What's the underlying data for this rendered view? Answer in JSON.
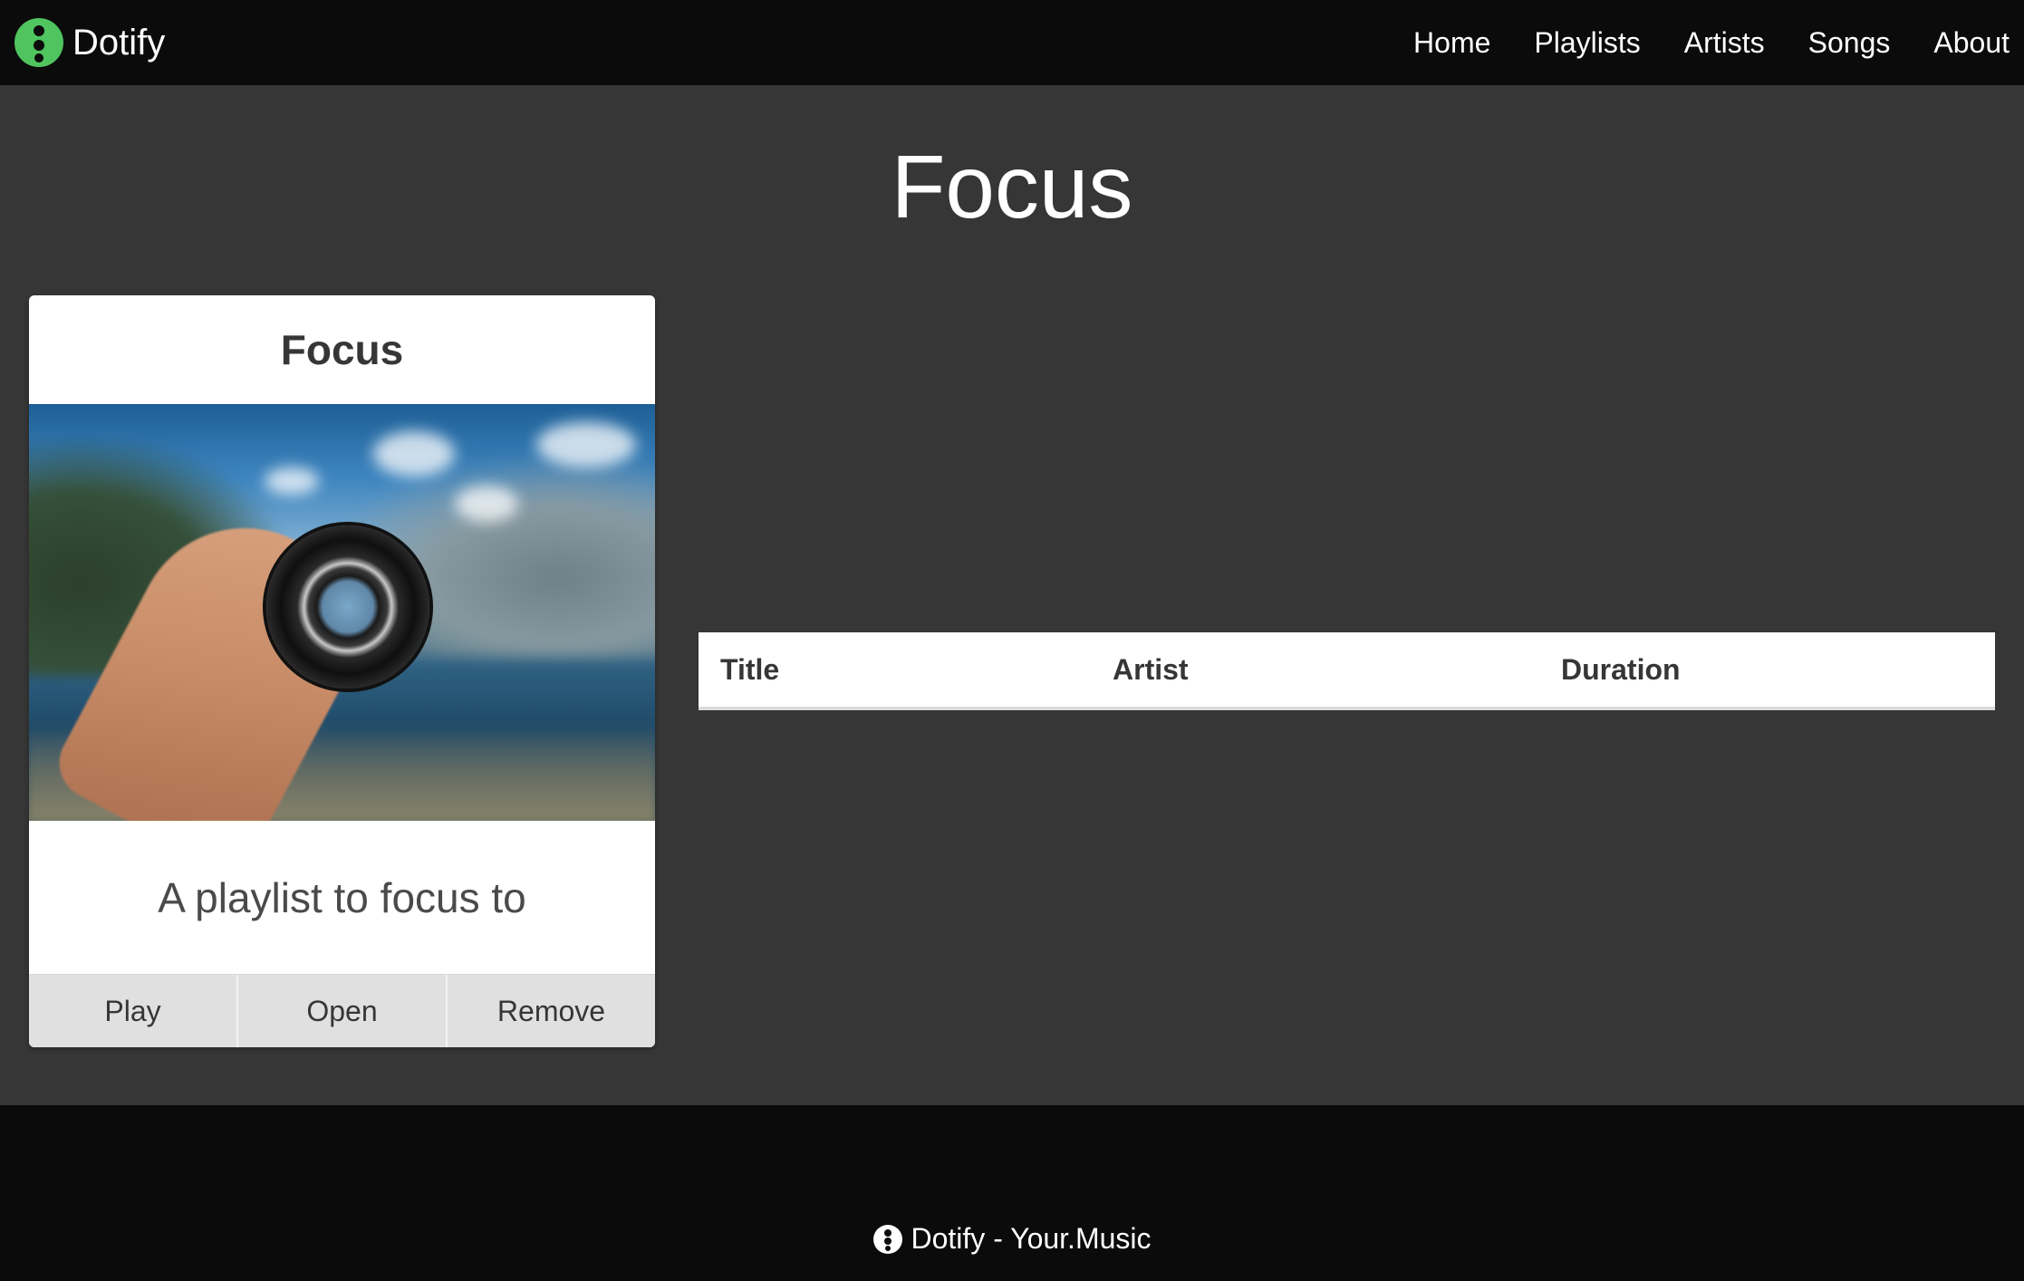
{
  "app": {
    "brand_name": "Dotify",
    "accent_color": "#4fc45f"
  },
  "nav": {
    "items": [
      {
        "label": "Home"
      },
      {
        "label": "Playlists"
      },
      {
        "label": "Artists"
      },
      {
        "label": "Songs"
      },
      {
        "label": "About"
      }
    ]
  },
  "page": {
    "title": "Focus"
  },
  "playlist_card": {
    "title": "Focus",
    "image_icon": "camera-lens-photo",
    "description": "A playlist to focus to",
    "buttons": {
      "play": "Play",
      "open": "Open",
      "remove": "Remove"
    }
  },
  "songs_table": {
    "columns": [
      "Title",
      "Artist",
      "Duration"
    ],
    "rows": []
  },
  "footer": {
    "text": "Dotify - Your.Music"
  }
}
